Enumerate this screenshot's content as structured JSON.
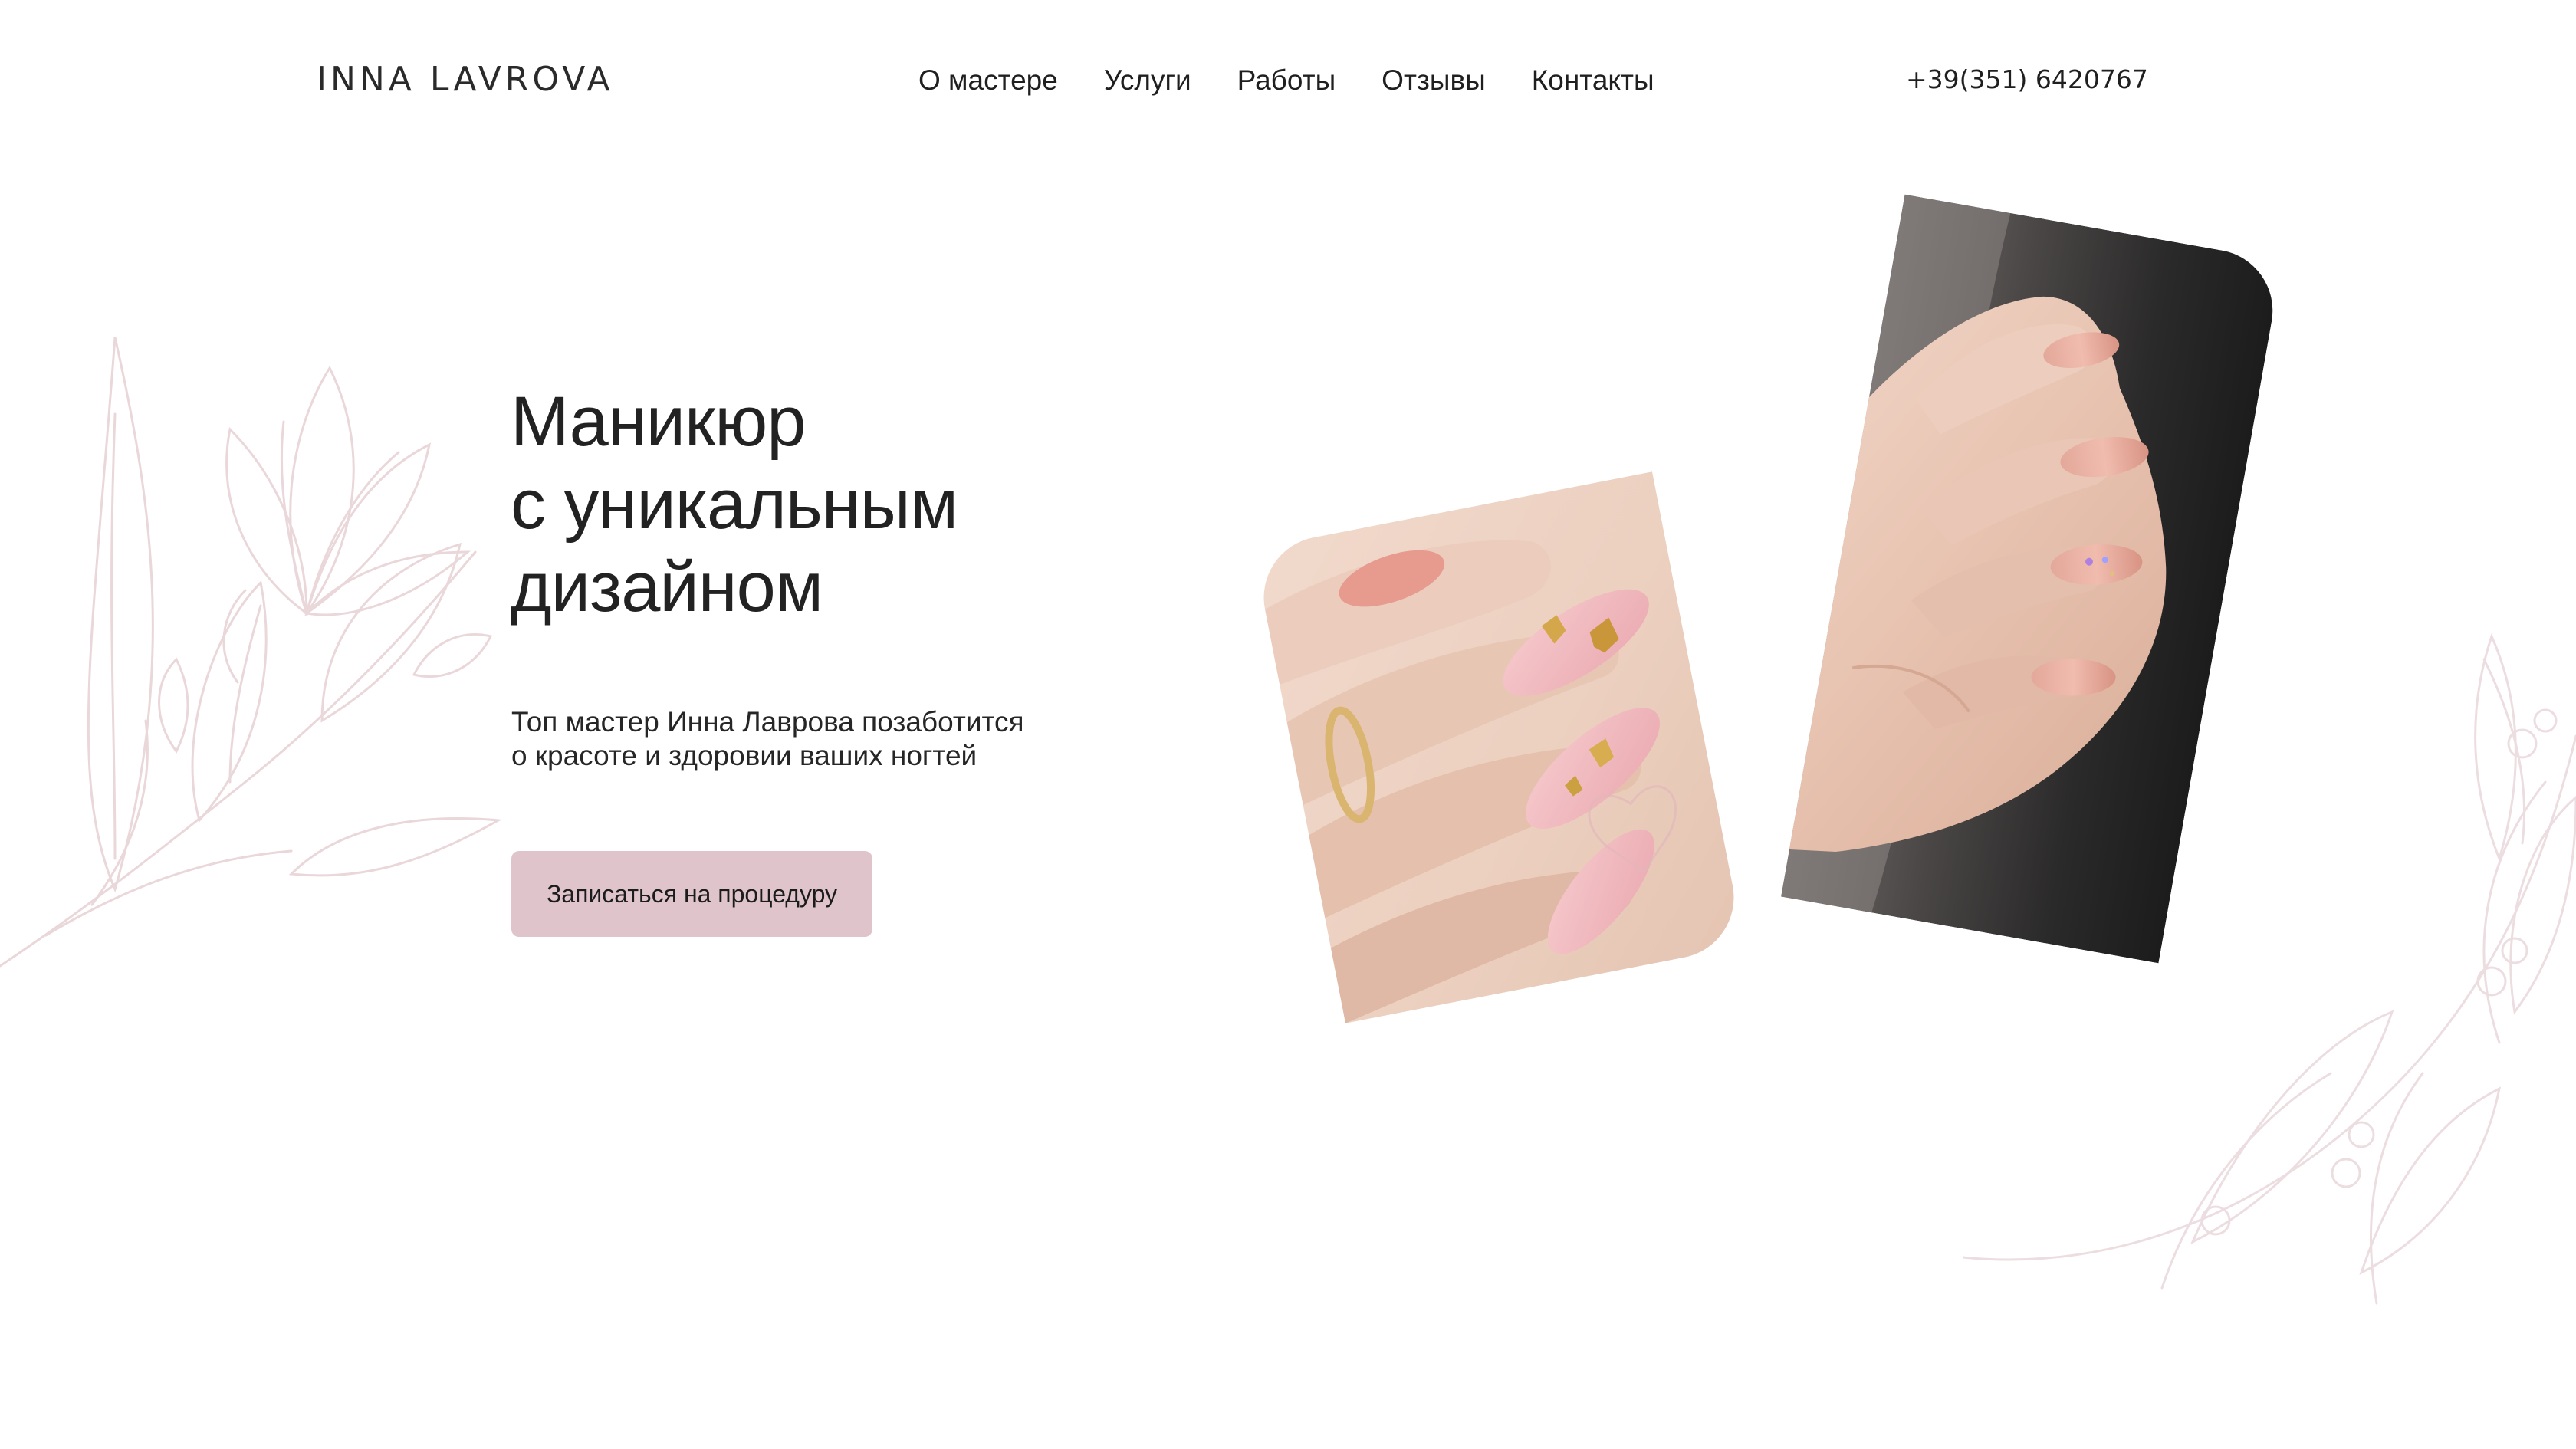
{
  "header": {
    "logo": "INNA LAVROVA",
    "nav": [
      {
        "label": "О мастере"
      },
      {
        "label": "Услуги"
      },
      {
        "label": "Работы"
      },
      {
        "label": "Отзывы"
      },
      {
        "label": "Контакты"
      }
    ],
    "phone": "+39(351) 6420767"
  },
  "hero": {
    "title_lines": [
      "Маникюр",
      "с уникальным",
      "дизайном"
    ],
    "subtitle_lines": [
      "Топ мастер Инна Лаврова позаботится",
      "о красоте и здоровии ваших ногтей"
    ],
    "cta_label": "Записаться на процедуру"
  },
  "colors": {
    "cta_background": "#dfc5cb",
    "text": "#1f1f1f",
    "floral_line": "#e9d6d9"
  },
  "icons": [
    "floral-left-decoration",
    "floral-right-decoration"
  ]
}
